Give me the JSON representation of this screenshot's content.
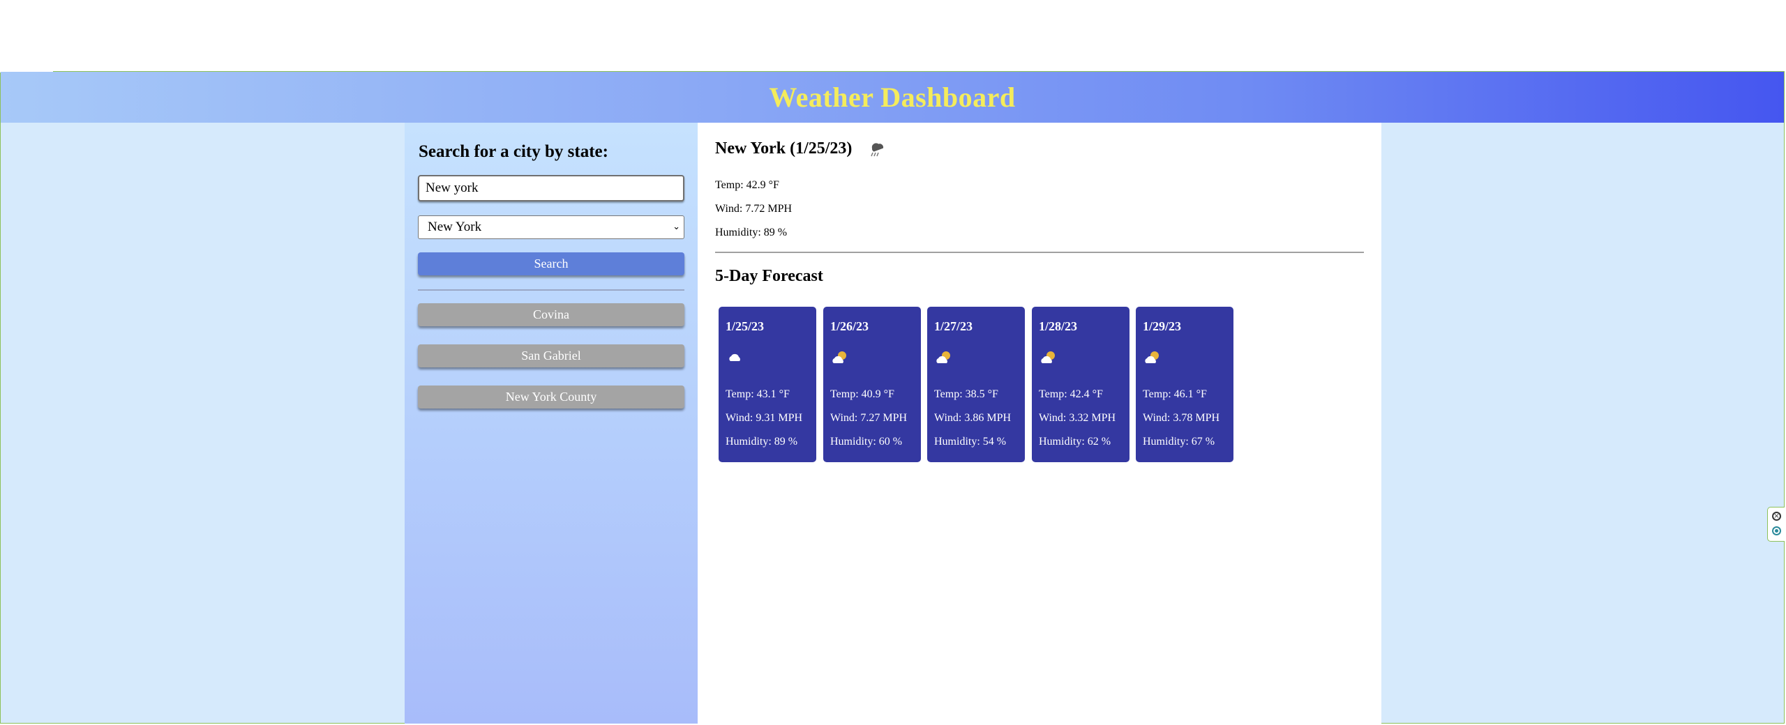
{
  "header": {
    "title": "Weather Dashboard"
  },
  "sidebar": {
    "heading": "Search for a city by state:",
    "city_input_value": "New york",
    "state_select_value": "New York",
    "search_label": "Search",
    "history": [
      "Covina",
      "San Gabriel",
      "New York County"
    ]
  },
  "current": {
    "title": "New York (1/25/23)",
    "icon": "rain-cloud-icon",
    "temp": "Temp: 42.9 °F",
    "wind": "Wind: 7.72 MPH",
    "humidity": "Humidity: 89 %"
  },
  "forecast": {
    "title": "5-Day Forecast",
    "days": [
      {
        "date": "1/25/23",
        "icon": "cloud-icon",
        "temp": "Temp: 43.1 °F",
        "wind": "Wind: 9.31 MPH",
        "humidity": "Humidity: 89 %"
      },
      {
        "date": "1/26/23",
        "icon": "partly-cloudy-icon",
        "temp": "Temp: 40.9 °F",
        "wind": "Wind: 7.27 MPH",
        "humidity": "Humidity: 60 %"
      },
      {
        "date": "1/27/23",
        "icon": "partly-cloudy-icon",
        "temp": "Temp: 38.5 °F",
        "wind": "Wind: 3.86 MPH",
        "humidity": "Humidity: 54 %"
      },
      {
        "date": "1/28/23",
        "icon": "partly-cloudy-icon",
        "temp": "Temp: 42.4 °F",
        "wind": "Wind: 3.32 MPH",
        "humidity": "Humidity: 62 %"
      },
      {
        "date": "1/29/23",
        "icon": "partly-cloudy-icon",
        "temp": "Temp: 46.1 °F",
        "wind": "Wind: 3.78 MPH",
        "humidity": "Humidity: 67 %"
      }
    ]
  },
  "colors": {
    "header_title": "#f4ec5c",
    "card_bg": "#3438a1",
    "search_button": "#5e7fd9",
    "history_button": "#a4a4a4",
    "page_bg": "#d6eafc"
  }
}
